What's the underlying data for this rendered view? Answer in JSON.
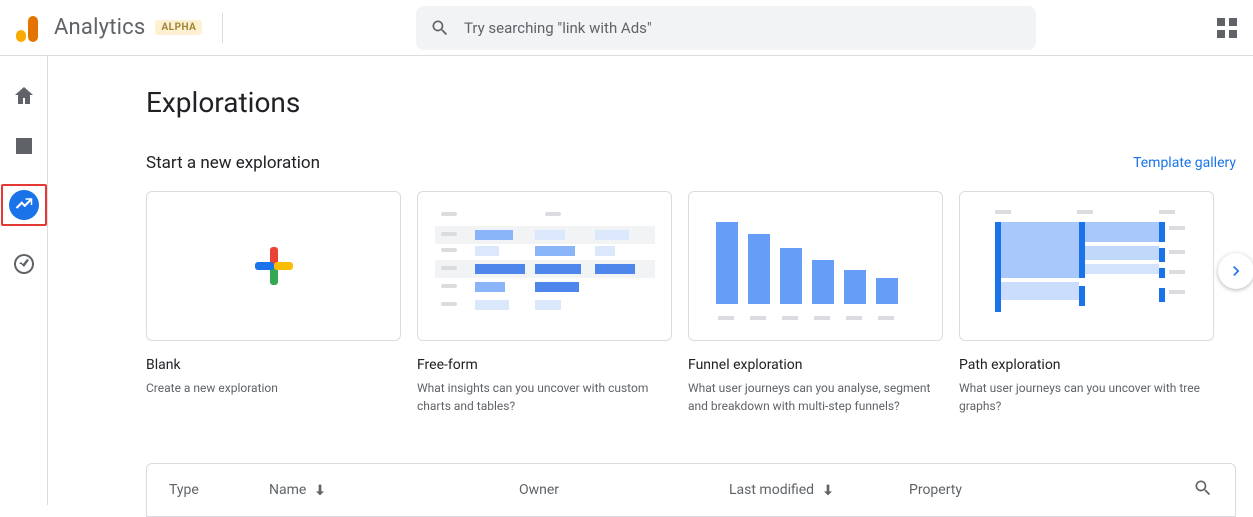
{
  "header": {
    "product": "Analytics",
    "badge": "ALPHA",
    "search_placeholder": "Try searching \"link with Ads\""
  },
  "nav": {
    "items": [
      "home",
      "reports",
      "explore",
      "advertising"
    ],
    "active": "explore"
  },
  "page": {
    "title": "Explorations",
    "subtitle": "Start a new exploration",
    "template_gallery": "Template gallery"
  },
  "cards": [
    {
      "title": "Blank",
      "desc": "Create a new exploration"
    },
    {
      "title": "Free-form",
      "desc": "What insights can you uncover with custom charts and tables?"
    },
    {
      "title": "Funnel exploration",
      "desc": "What user journeys can you analyse, segment and breakdown with multi-step funnels?"
    },
    {
      "title": "Path exploration",
      "desc": "What user journeys can you uncover with tree graphs?"
    }
  ],
  "table": {
    "headers": {
      "type": "Type",
      "name": "Name",
      "owner": "Owner",
      "modified": "Last modified",
      "property": "Property"
    }
  }
}
